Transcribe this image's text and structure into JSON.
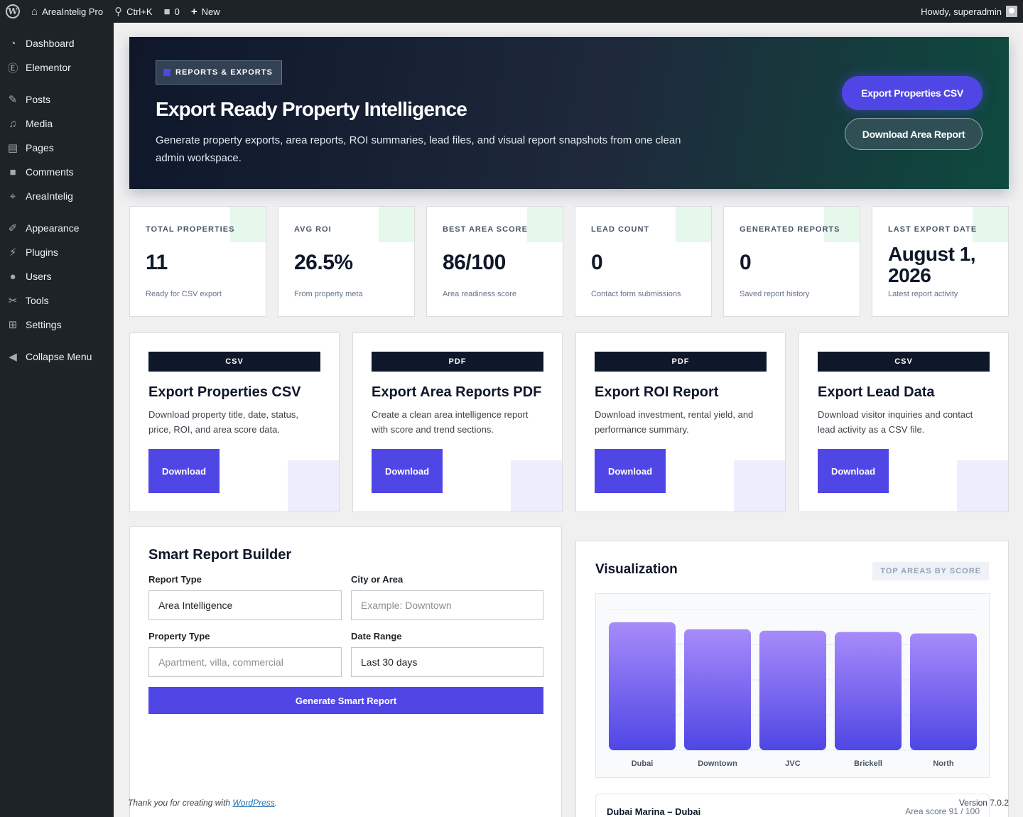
{
  "adminbar": {
    "site_name": "AreaIntelig Pro",
    "search_shortcut": "Ctrl+K",
    "comments_count": "0",
    "new_label": "New",
    "howdy": "Howdy, superadmin"
  },
  "sidebar": {
    "items": [
      {
        "label": "Dashboard",
        "icon": "dashboard-icon"
      },
      {
        "label": "Elementor",
        "icon": "elementor-icon"
      },
      {
        "label": "Posts",
        "icon": "pin-icon"
      },
      {
        "label": "Media",
        "icon": "media-icon"
      },
      {
        "label": "Pages",
        "icon": "pages-icon"
      },
      {
        "label": "Comments",
        "icon": "comment-icon"
      },
      {
        "label": "AreaIntelig",
        "icon": "map-icon"
      },
      {
        "label": "Appearance",
        "icon": "brush-icon"
      },
      {
        "label": "Plugins",
        "icon": "plug-icon"
      },
      {
        "label": "Users",
        "icon": "user-icon"
      },
      {
        "label": "Tools",
        "icon": "wrench-icon"
      },
      {
        "label": "Settings",
        "icon": "settings-icon"
      },
      {
        "label": "Collapse Menu",
        "icon": "collapse-icon"
      }
    ]
  },
  "hero": {
    "chip": "REPORTS & EXPORTS",
    "title": "Export Ready Property Intelligence",
    "description": "Generate property exports, area reports, ROI summaries, lead files, and visual report snapshots from one clean admin workspace.",
    "primary_button": "Export Properties CSV",
    "secondary_button": "Download Area Report"
  },
  "stats": [
    {
      "label": "TOTAL PROPERTIES",
      "value": "11",
      "sub": "Ready for CSV export"
    },
    {
      "label": "AVG ROI",
      "value": "26.5%",
      "sub": "From property meta"
    },
    {
      "label": "BEST AREA SCORE",
      "value": "86/100",
      "sub": "Area readiness score"
    },
    {
      "label": "LEAD COUNT",
      "value": "0",
      "sub": "Contact form submissions"
    },
    {
      "label": "GENERATED REPORTS",
      "value": "0",
      "sub": "Saved report history"
    },
    {
      "label": "LAST EXPORT DATE",
      "value": "August 1, 2026",
      "sub": "Latest report activity"
    }
  ],
  "exports": [
    {
      "tag": "CSV",
      "title": "Export Properties CSV",
      "description": "Download property title, date, status, price, ROI, and area score data.",
      "button": "Download"
    },
    {
      "tag": "PDF",
      "title": "Export Area Reports PDF",
      "description": "Create a clean area intelligence report with score and trend sections.",
      "button": "Download"
    },
    {
      "tag": "PDF",
      "title": "Export ROI Report",
      "description": "Download investment, rental yield, and performance summary.",
      "button": "Download"
    },
    {
      "tag": "CSV",
      "title": "Export Lead Data",
      "description": "Download visitor inquiries and contact lead activity as a CSV file.",
      "button": "Download"
    }
  ],
  "builder": {
    "title": "Smart Report Builder",
    "report_type_label": "Report Type",
    "report_type_value": "Area Intelligence",
    "city_label": "City or Area",
    "city_placeholder": "Example: Downtown",
    "property_type_label": "Property Type",
    "property_type_placeholder": "Apartment, villa, commercial",
    "date_range_label": "Date Range",
    "date_range_value": "Last 30 days",
    "button": "Generate Smart Report"
  },
  "visualization": {
    "title": "Visualization",
    "badge": "TOP AREAS BY SCORE",
    "first_row_name": "Dubai Marina – Dubai",
    "first_row_score": "Area score 91 / 100"
  },
  "chart_data": {
    "type": "bar",
    "categories": [
      "Dubai",
      "Downtown",
      "JVC",
      "Brickell",
      "North"
    ],
    "values": [
      91,
      86,
      85,
      84,
      83
    ],
    "ylim": [
      0,
      100
    ],
    "grid": true,
    "colors": {
      "top": "#a78bfa",
      "bottom": "#4f46e5"
    }
  },
  "footer": {
    "thanks_prefix": "Thank you for creating with ",
    "thanks_link": "WordPress",
    "thanks_suffix": ".",
    "version": "Version 7.0.2"
  }
}
